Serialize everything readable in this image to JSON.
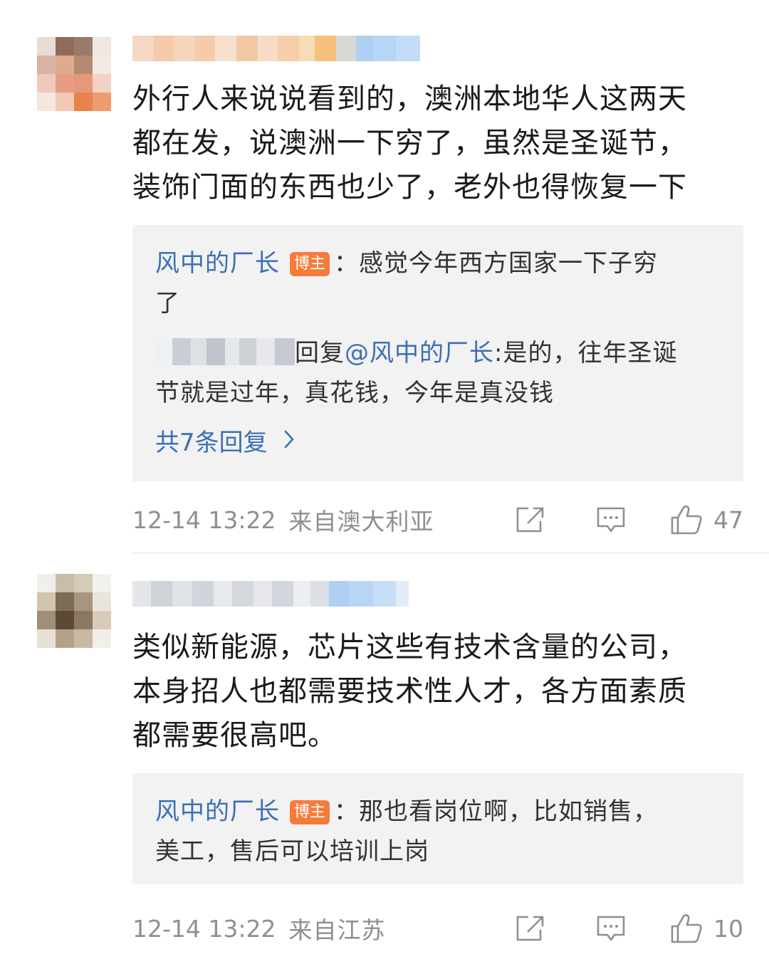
{
  "comments": [
    {
      "text_lines": [
        "外行人来说说看到的，澳洲本地华人这两天",
        "都在发，说澳洲一下穷了，虽然是圣诞节，",
        "装饰门面的东西也少了，老外也得恢复一下"
      ],
      "reply": {
        "author": "风中的厂长",
        "badge": "博主",
        "text_line1": "：感觉今年西方国家一下子穷",
        "text_line2": "了",
        "sub_reply_prefix": "回复",
        "sub_reply_mention": "@风中的厂长",
        "sub_reply_text1": ":是的，往年圣诞",
        "sub_reply_text2": "节就是过年，真花钱，今年是真没钱",
        "more_label": "共7条回复"
      },
      "time": "12-14 13:22",
      "location": "来自澳大利亚",
      "likes": "47"
    },
    {
      "text_lines": [
        "类似新能源，芯片这些有技术含量的公司，",
        "本身招人也都需要技术性人才，各方面素质",
        "都需要很高吧。"
      ],
      "reply": {
        "author": "风中的厂长",
        "badge": "博主",
        "text_line1": "：那也看岗位啊，比如销售，",
        "text_line2": "美工，售后可以培训上岗"
      },
      "time": "12-14 13:22",
      "location": "来自江苏",
      "likes": "10"
    }
  ],
  "icons": [
    "share-icon",
    "comment-icon",
    "like-icon",
    "chevron-right-icon"
  ],
  "colors": {
    "link": "#3b6fb6",
    "badge": "#f57b3a",
    "meta": "#8f8f8f",
    "reply_bg": "#f2f2f2"
  }
}
